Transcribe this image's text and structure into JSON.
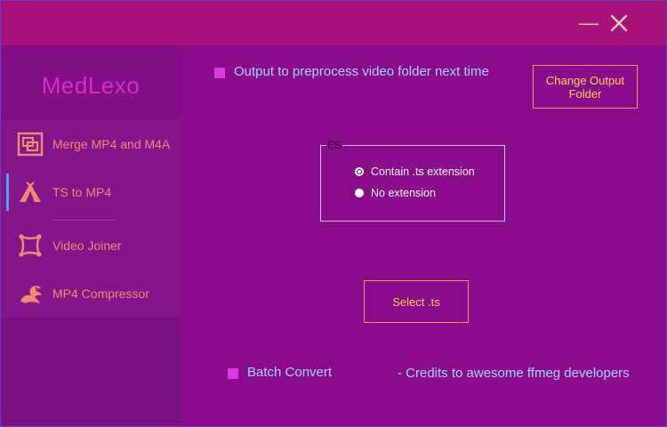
{
  "window": {
    "minimize_label": "—",
    "close_icon": "close-icon"
  },
  "sidebar": {
    "logo": "MedLexo",
    "items": [
      {
        "label": "Merge MP4 and M4A",
        "icon": "merge-icon"
      },
      {
        "label": "TS to MP4",
        "icon": "tent-icon"
      },
      {
        "label": "Video Joiner",
        "icon": "frame-crop-icon"
      },
      {
        "label": "MP4 Compressor",
        "icon": "dragon-icon"
      }
    ],
    "active_index": 1
  },
  "main": {
    "output_checkbox_label": "Output to preprocess video folder next time",
    "change_output_button": "Change Output Folder",
    "group": {
      "title": "ES",
      "options": [
        {
          "label": "Contain .ts extension",
          "selected": true
        },
        {
          "label": "No extension",
          "selected": false
        }
      ]
    },
    "select_button": "Select .ts",
    "batch_checkbox_label": "Batch Convert",
    "credits": "- Credits to awesome ffmeg developers"
  },
  "colors": {
    "background": "#8a0c8c",
    "titlebar": "#a8107a",
    "sidebar": "#7a0f80",
    "logo": "#d92bd0",
    "nav_text": "#f08a70",
    "accent_text": "#9fd7ff",
    "button_text": "#ffd84a",
    "button_border": "#e7a23c",
    "active_indicator": "#4aa3ff"
  }
}
